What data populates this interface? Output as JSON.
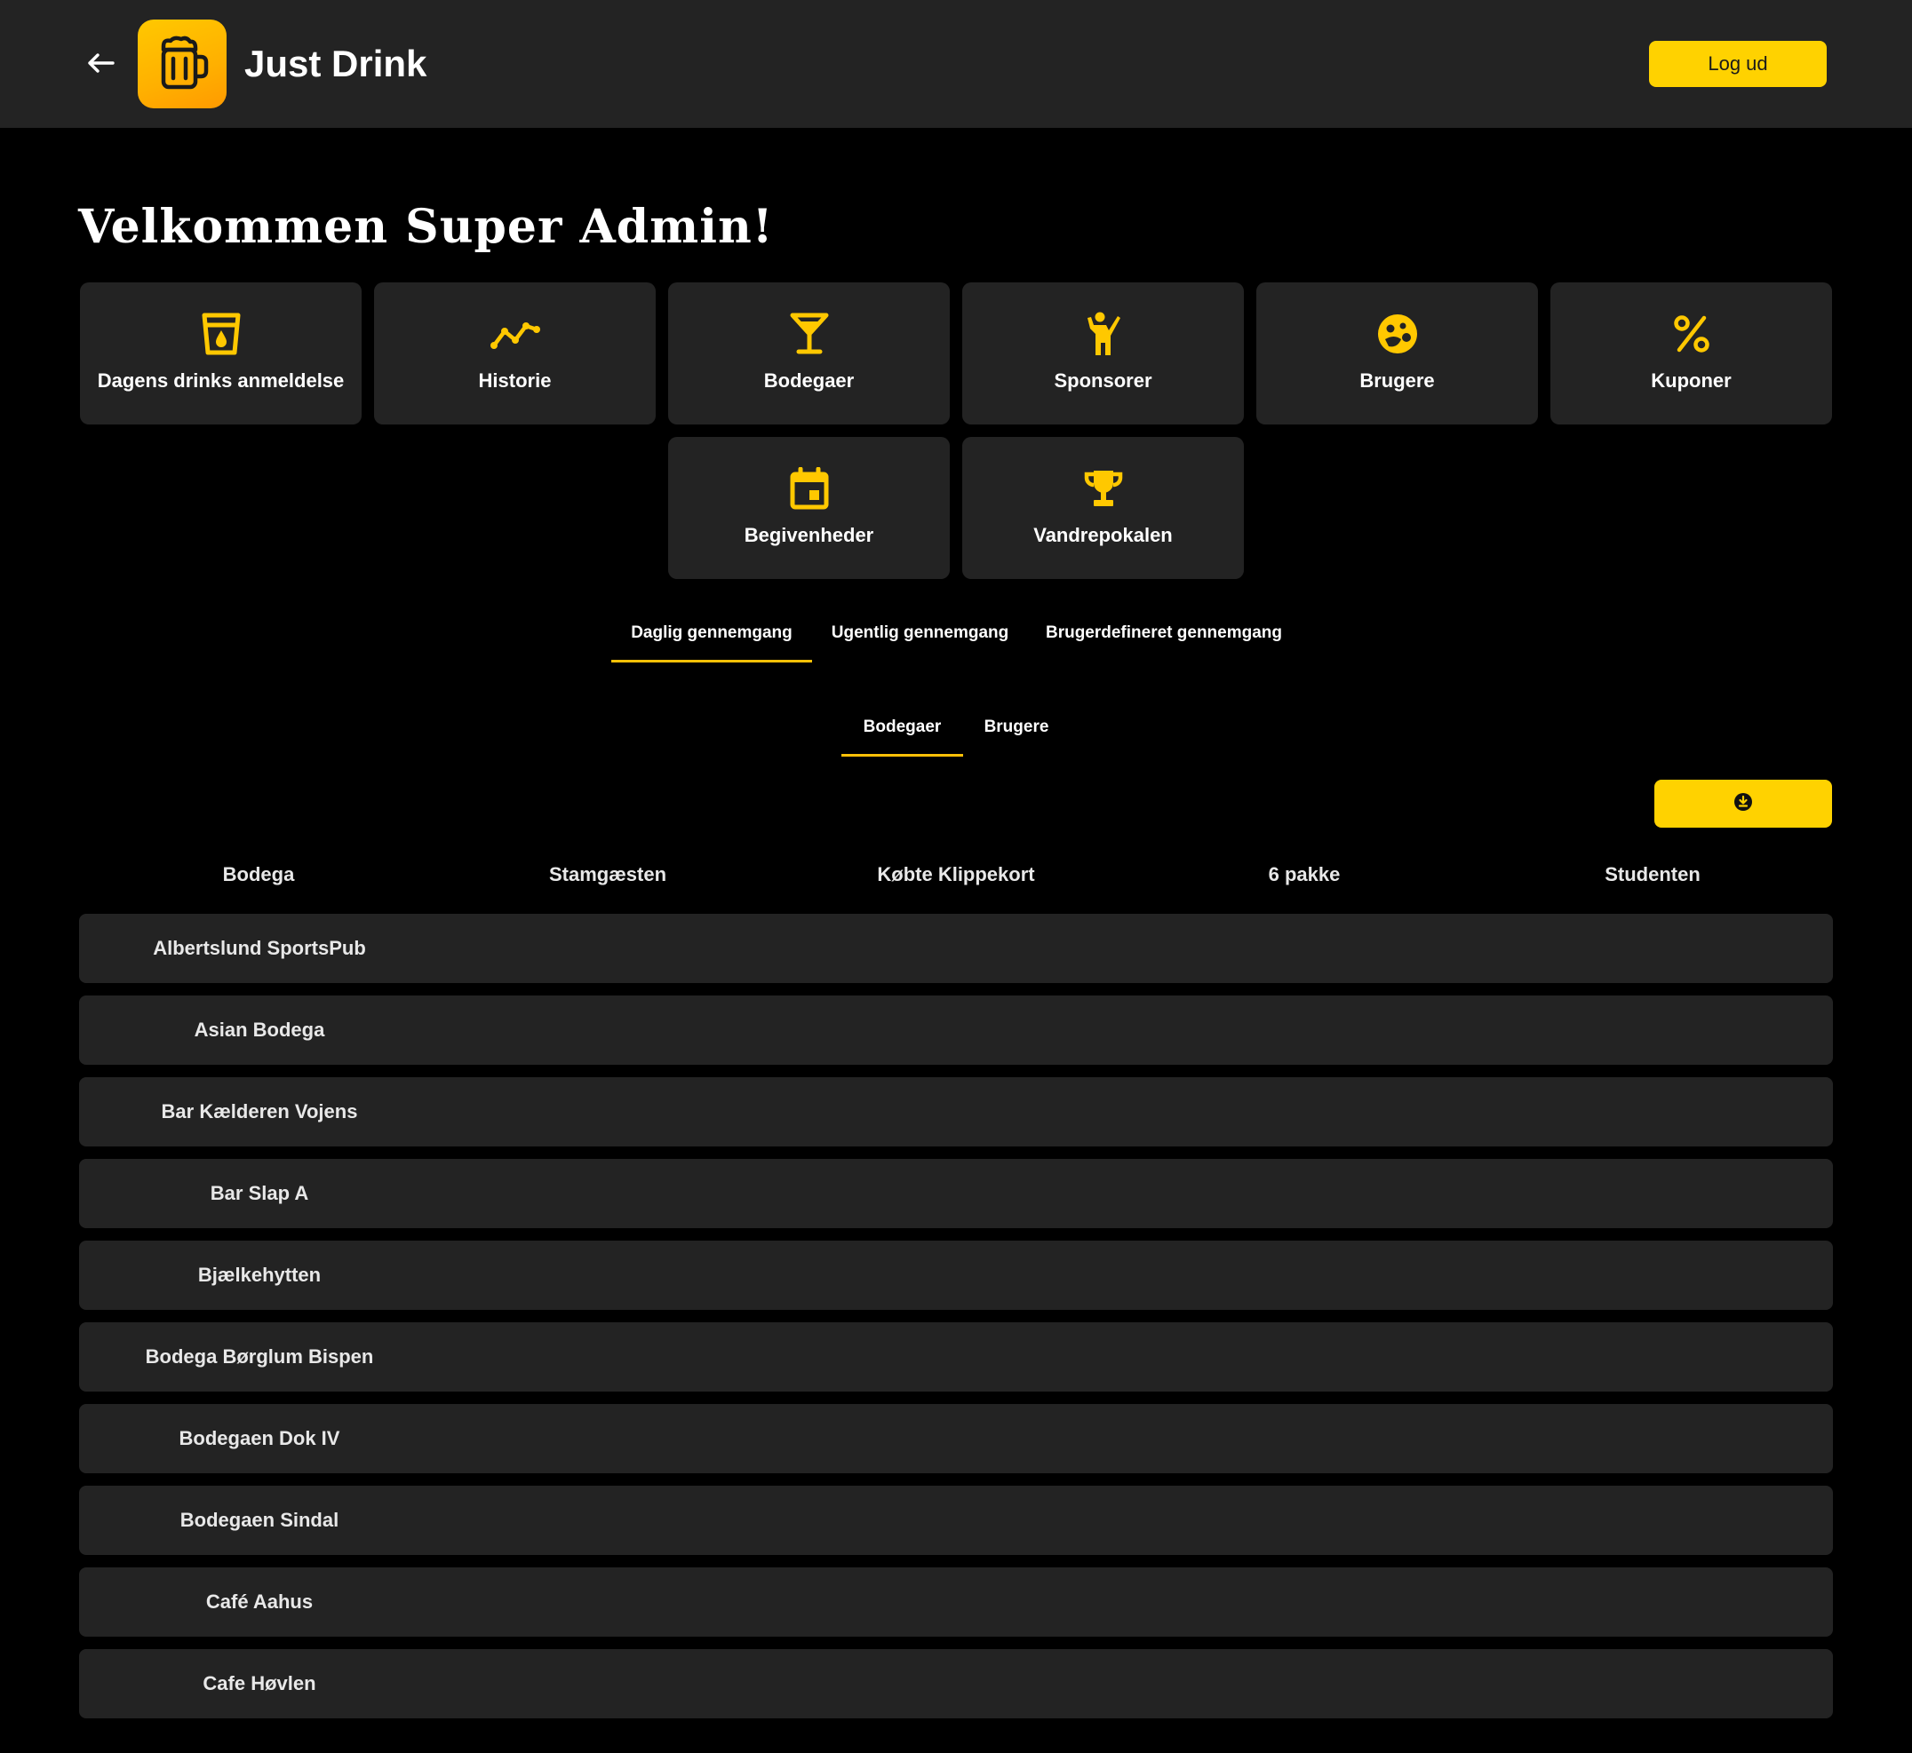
{
  "header": {
    "app_title": "Just Drink",
    "logout_label": "Log ud"
  },
  "welcome": "Velkommen Super Admin!",
  "tiles": [
    {
      "label": "Dagens drinks anmeldelse",
      "icon": "drink-review-icon"
    },
    {
      "label": "Historie",
      "icon": "history-chart-icon"
    },
    {
      "label": "Bodegaer",
      "icon": "cocktail-glass-icon"
    },
    {
      "label": "Sponsorer",
      "icon": "person-waving-icon"
    },
    {
      "label": "Brugere",
      "icon": "users-face-icon"
    },
    {
      "label": "Kuponer",
      "icon": "percent-icon"
    },
    {
      "label": "Begivenheder",
      "icon": "calendar-icon"
    },
    {
      "label": "Vandrepokalen",
      "icon": "trophy-icon"
    }
  ],
  "period_tabs": {
    "daily": "Daglig gennemgang",
    "weekly": "Ugentlig gennemgang",
    "custom": "Brugerdefineret gennemgang",
    "active": "daily"
  },
  "entity_tabs": {
    "bars": "Bodegaer",
    "users": "Brugere",
    "active": "bars"
  },
  "table": {
    "columns": [
      "Bodega",
      "Stamgæsten",
      "Købte Klippekort",
      "6 pakke",
      "Studenten"
    ],
    "rows": [
      "Albertslund SportsPub",
      "Asian Bodega",
      "Bar Kælderen Vojens",
      "Bar Slap A",
      "Bjælkehytten",
      "Bodega Børglum Bispen",
      "Bodegaen Dok IV",
      "Bodegaen Sindal",
      "Café Aahus",
      "Cafe Høvlen"
    ]
  },
  "colors": {
    "accent": "#ffd200",
    "background": "#000000",
    "surface": "#232323"
  }
}
